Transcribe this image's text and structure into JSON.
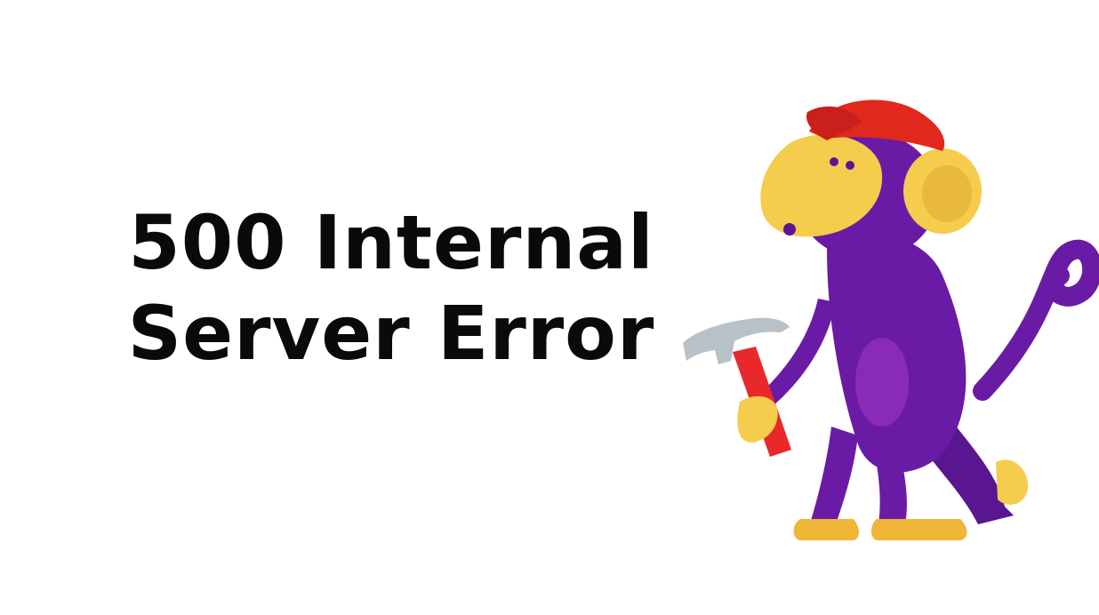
{
  "error": {
    "line1": "500 Internal",
    "line2": "Server Error"
  },
  "illustration": {
    "icon": "monkey-with-hammer-icon",
    "colors": {
      "body": "#6a1ba6",
      "body_light": "#8a2bb8",
      "face": "#f5cc4c",
      "face_dark": "#e8b93a",
      "cap": "#e0281c",
      "hammer_handle": "#e8282b",
      "hammer_head": "#b8c0c8",
      "feet": "#f0b637"
    }
  }
}
